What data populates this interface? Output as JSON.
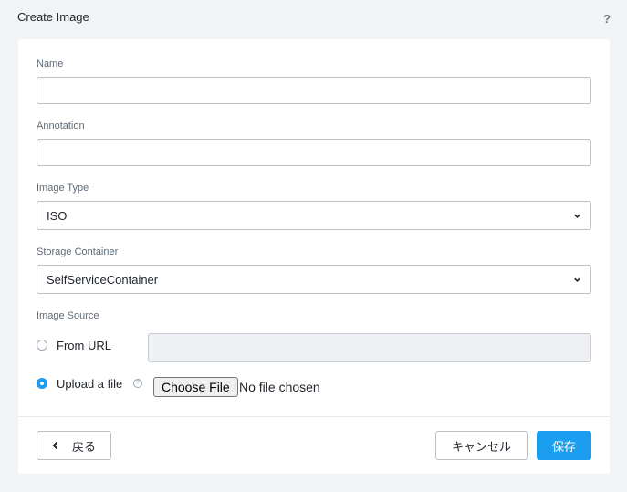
{
  "dialog": {
    "title": "Create Image",
    "help_icon": "?"
  },
  "form": {
    "name": {
      "label": "Name",
      "value": ""
    },
    "annotation": {
      "label": "Annotation",
      "value": ""
    },
    "image_type": {
      "label": "Image Type",
      "selected": "ISO"
    },
    "storage_container": {
      "label": "Storage Container",
      "selected": "SelfServiceContainer"
    },
    "image_source": {
      "label": "Image Source",
      "from_url": {
        "label": "From URL",
        "checked": false,
        "value": ""
      },
      "upload_file": {
        "label": "Upload a file",
        "checked": true,
        "info_icon": "?",
        "choose_file_label": "Choose File",
        "no_file_text": "No file chosen"
      }
    }
  },
  "footer": {
    "back_label": "戻る",
    "cancel_label": "キャンセル",
    "save_label": "保存"
  },
  "colors": {
    "accent": "#1b9ef0",
    "background": "#f2f3f5",
    "panel": "#ffffff"
  },
  "icons": {
    "help": "question-mark-icon",
    "chevron": "chevron-down-icon",
    "back": "chevron-left-icon",
    "info": "info-icon"
  }
}
